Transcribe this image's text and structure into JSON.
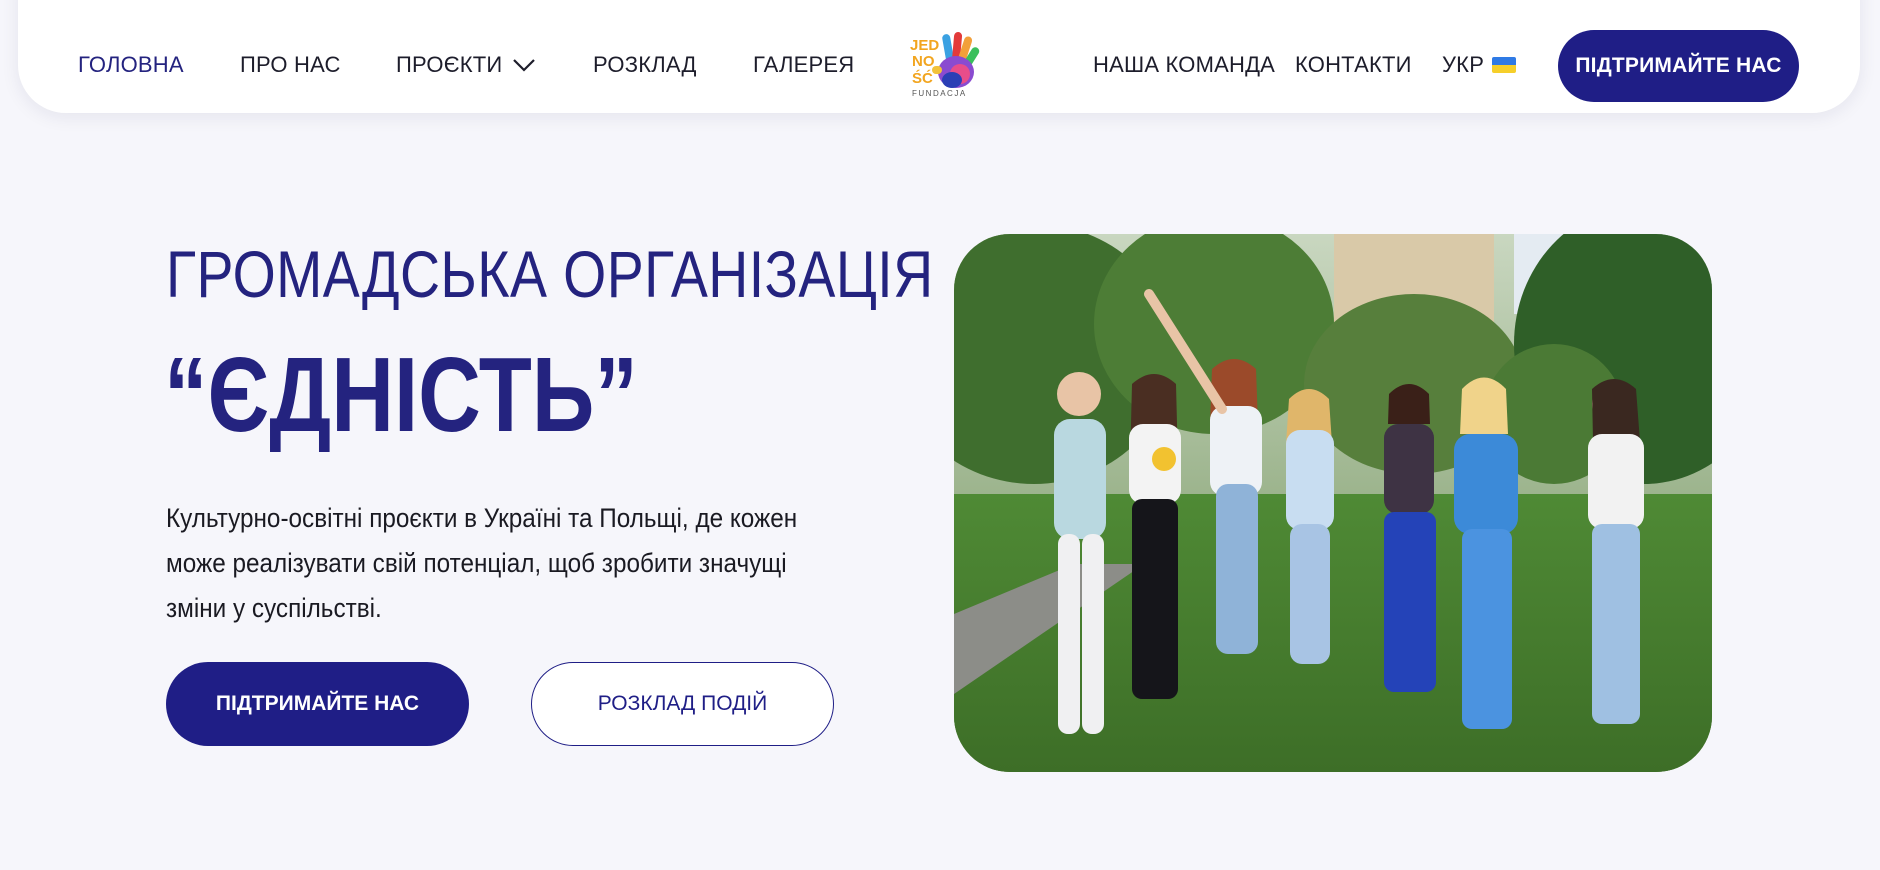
{
  "nav": {
    "home": "Головна",
    "about": "Про нас",
    "projects": "Проєкти",
    "schedule": "Розклад",
    "gallery": "Галерея",
    "team": "Наша команда",
    "contacts": "Контакти",
    "language": "УКР",
    "support_button": "Підтримайте нас"
  },
  "logo": {
    "text_line1": "JED",
    "text_line2": "NO",
    "text_line3": "ŚĆ",
    "subtitle": "FUNDACJA"
  },
  "hero": {
    "title": "ГРОМАДСЬКА ОРГАНІЗАЦІЯ",
    "name": "“ЄДНІСТЬ”",
    "description": "Культурно-освітні проєкти в Україні та Польщі, де кожен може реалізувати свій потенціал, щоб зробити значущі зміни у суспільстві.",
    "primary_button": "Підтримайте нас",
    "secondary_button": "Розклад подій"
  },
  "colors": {
    "accent": "#1f1e86",
    "background": "#f6f6fb",
    "header_bg": "#ffffff",
    "flag_blue": "#2f7ae5",
    "flag_yellow": "#f6cf2a"
  },
  "icons": {
    "projects_dropdown": "chevron-down-icon",
    "language_flag": "ukraine-flag-icon"
  }
}
